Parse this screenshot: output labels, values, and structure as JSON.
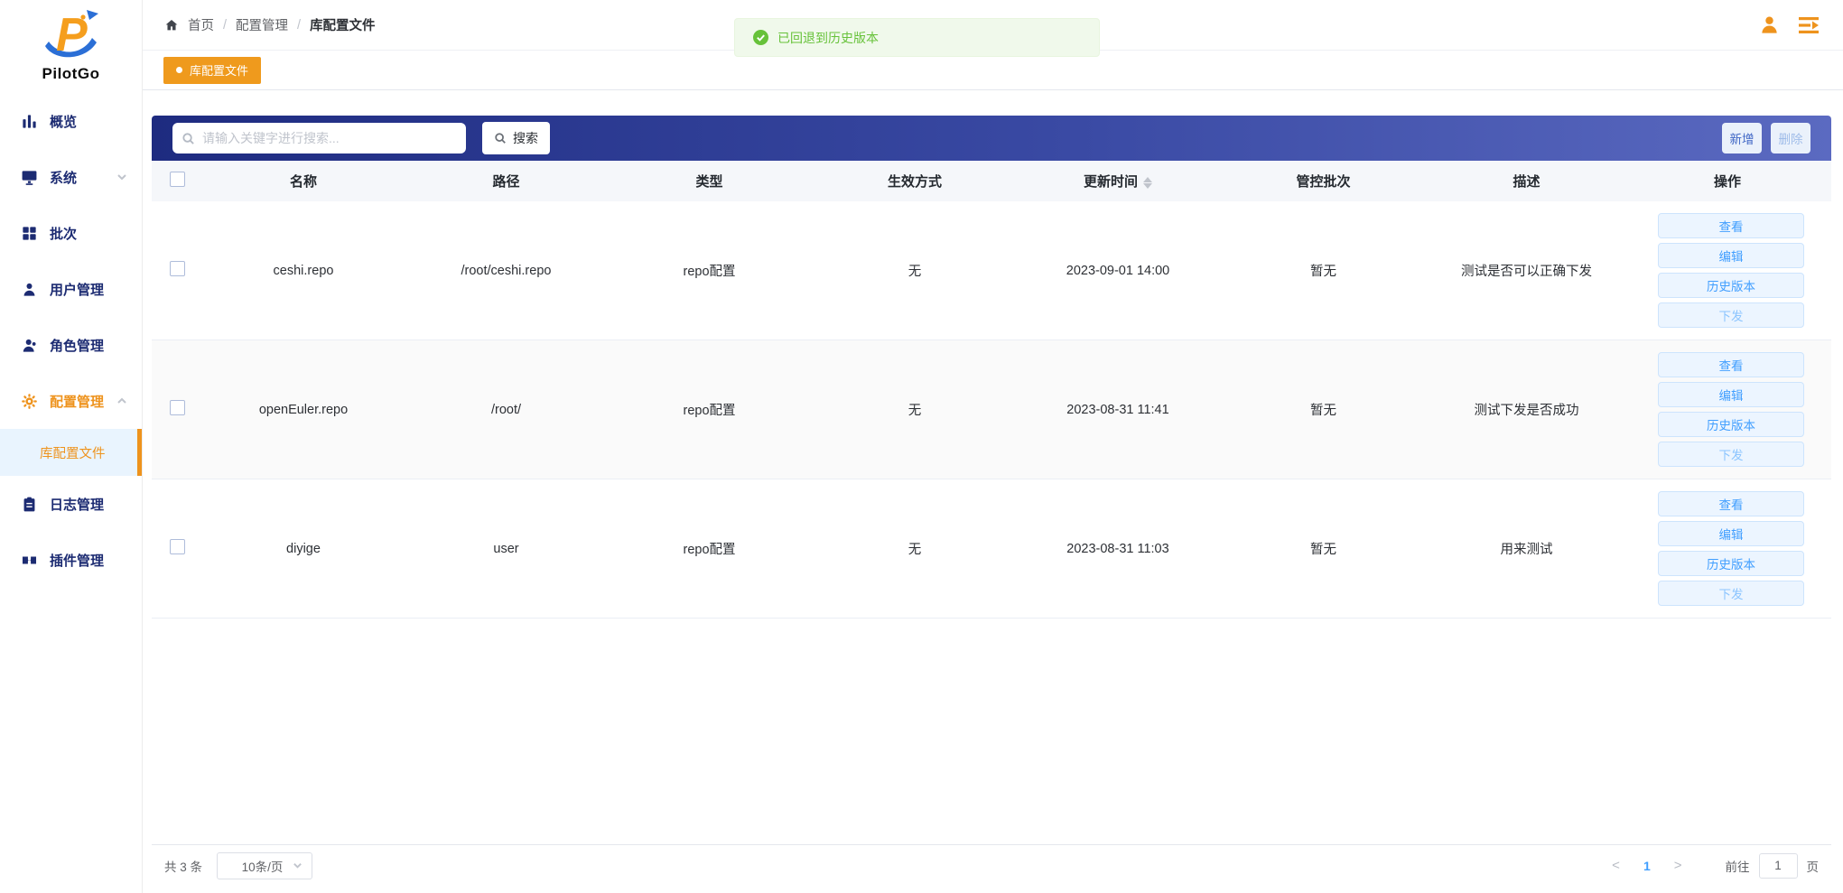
{
  "brand": {
    "name": "PilotGo"
  },
  "topbar": {
    "breadcrumb": [
      "首页",
      "配置管理",
      "库配置文件"
    ],
    "separator": "/"
  },
  "toast": {
    "message": "已回退到历史版本"
  },
  "tabstrip": {
    "active_tab": "库配置文件"
  },
  "sidebar": {
    "items": [
      {
        "label": "概览"
      },
      {
        "label": "系统"
      },
      {
        "label": "批次"
      },
      {
        "label": "用户管理"
      },
      {
        "label": "角色管理"
      },
      {
        "label": "配置管理"
      },
      {
        "label": "日志管理"
      },
      {
        "label": "插件管理"
      }
    ],
    "active_subitem": {
      "label": "库配置文件"
    }
  },
  "toolbar": {
    "search_placeholder": "请输入关键字进行搜索...",
    "search_button": "搜索",
    "add_button": "新增",
    "delete_button": "删除"
  },
  "table": {
    "columns": [
      "名称",
      "路径",
      "类型",
      "生效方式",
      "更新时间",
      "管控批次",
      "描述",
      "操作"
    ],
    "actions": [
      "查看",
      "编辑",
      "历史版本",
      "下发"
    ],
    "rows": [
      {
        "name": "ceshi.repo",
        "path": "/root/ceshi.repo",
        "type": "repo配置",
        "effect": "无",
        "updated": "2023-09-01 14:00",
        "batch": "暂无",
        "description": "测试是否可以正确下发"
      },
      {
        "name": "openEuler.repo",
        "path": "/root/",
        "type": "repo配置",
        "effect": "无",
        "updated": "2023-08-31 11:41",
        "batch": "暂无",
        "description": "测试下发是否成功"
      },
      {
        "name": "diyige",
        "path": "user",
        "type": "repo配置",
        "effect": "无",
        "updated": "2023-08-31 11:03",
        "batch": "暂无",
        "description": "用来测试"
      }
    ]
  },
  "pagination": {
    "total": "共 3 条",
    "page_size": "10条/页",
    "current_page": "1",
    "goto_label": "前往",
    "goto_value": "1",
    "unit_label": "页"
  },
  "colors": {
    "accent_orange": "#ee931d",
    "navy": "#1c2b72",
    "primary_blue": "#409eff",
    "success_green": "#67c23a",
    "bar_gradient_start": "#1e2b80",
    "bar_gradient_end": "#5b6ac1"
  }
}
